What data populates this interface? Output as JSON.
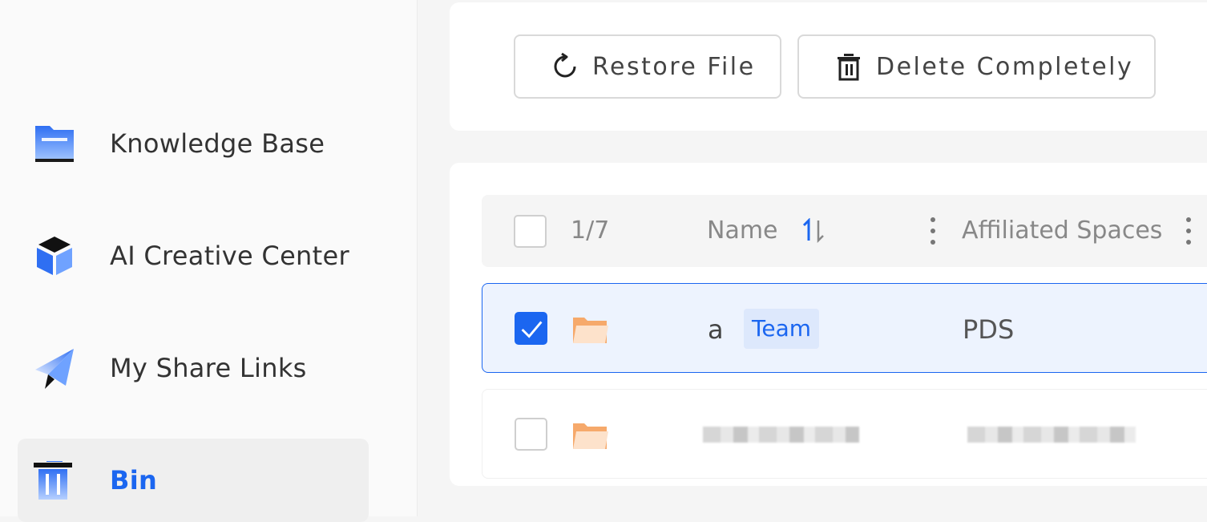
{
  "sidebar": {
    "items": [
      {
        "label": "Knowledge Base",
        "icon": "folder-icon"
      },
      {
        "label": "AI Creative Center",
        "icon": "cube-icon"
      },
      {
        "label": "My Share Links",
        "icon": "paper-plane-icon"
      },
      {
        "label": "Bin",
        "icon": "trash-icon",
        "active": true
      }
    ]
  },
  "toolbar": {
    "restore_label": "Restore File",
    "delete_label": "Delete Completely"
  },
  "table": {
    "selection_count": "1/7",
    "columns": {
      "name": "Name",
      "affiliated_spaces": "Affiliated Spaces"
    },
    "rows": [
      {
        "name": "a",
        "tag": "Team",
        "space": "PDS",
        "selected": true
      },
      {
        "name": "",
        "space": "",
        "selected": false,
        "redacted": true
      }
    ]
  },
  "colors": {
    "accent": "#1b66f0",
    "selected_row_bg": "#edf3fe",
    "folder": "#f6a96b"
  }
}
